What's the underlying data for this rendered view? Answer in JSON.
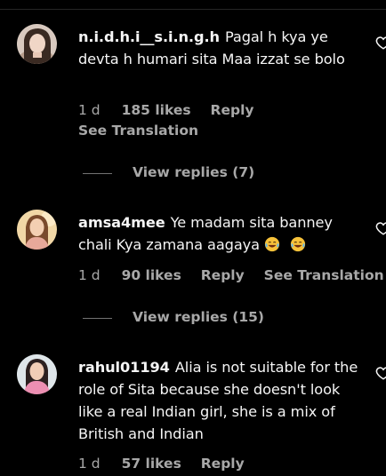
{
  "comments": [
    {
      "username": "n.i.d.h.i__s.i.n.g.h",
      "text": "Pagal h kya ye devta h humari sita Maa izzat se bolo",
      "time": "1 d",
      "likes": "185 likes",
      "reply": "Reply",
      "translation": "See Translation",
      "view_replies": "View replies (7)"
    },
    {
      "username": "amsa4mee",
      "text": "Ye madam sita banney chali Kya zamana aagaya",
      "emojis": [
        "face-with-tears-of-joy",
        "face-with-tears-of-joy"
      ],
      "time": "1 d",
      "likes": "90 likes",
      "reply": "Reply",
      "translation": "See Translation",
      "view_replies": "View replies (15)"
    },
    {
      "username": "rahul01194",
      "text": "Alia is not suitable for the role of Sita because she doesn't look like a real Indian girl, she is a mix of British and Indian",
      "time": "1 d",
      "likes": "57 likes",
      "reply": "Reply"
    }
  ],
  "icons": {
    "like": "heart-outline-icon"
  },
  "colors": {
    "background": "#000000",
    "primary_text": "#f5f5f5",
    "secondary_text": "#a8a8a8"
  }
}
